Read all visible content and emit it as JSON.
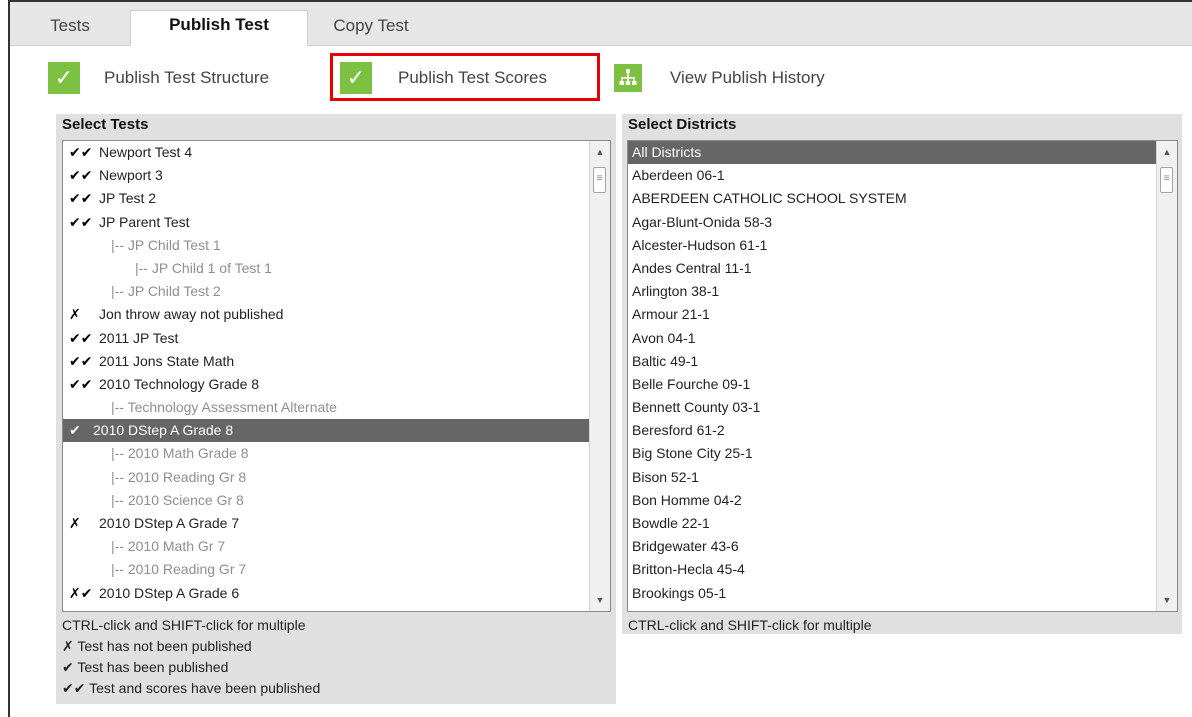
{
  "tabs": [
    {
      "label": "Tests"
    },
    {
      "label": "Publish Test"
    },
    {
      "label": "Copy Test"
    }
  ],
  "actions": [
    {
      "label": "Publish Test Structure",
      "icon": "checkmark-icon"
    },
    {
      "label": "Publish Test Scores",
      "icon": "checkmark-icon"
    },
    {
      "label": "View Publish History",
      "icon": "hierarchy-icon"
    }
  ],
  "tests_panel": {
    "title": "Select Tests",
    "hint": "CTRL-click and SHIFT-click for multiple",
    "items": [
      {
        "mark": "✔✔",
        "label": "Newport Test 4",
        "level": 0
      },
      {
        "mark": "✔✔",
        "label": "Newport 3",
        "level": 0
      },
      {
        "mark": "✔✔",
        "label": "JP Test 2",
        "level": 0
      },
      {
        "mark": "✔✔",
        "label": "JP Parent Test",
        "level": 0
      },
      {
        "mark": "",
        "label": "|-- JP Child Test 1",
        "level": 1
      },
      {
        "mark": "",
        "label": "|-- JP Child 1 of Test 1",
        "level": 2
      },
      {
        "mark": "",
        "label": "|-- JP Child Test 2",
        "level": 1
      },
      {
        "mark": "✗",
        "label": "Jon throw away not published",
        "level": 0
      },
      {
        "mark": "✔✔",
        "label": "2011 JP Test",
        "level": 0
      },
      {
        "mark": "✔✔",
        "label": "2011 Jons State Math",
        "level": 0
      },
      {
        "mark": "✔✔",
        "label": "2010 Technology Grade 8",
        "level": 0
      },
      {
        "mark": "",
        "label": "|-- Technology Assessment Alternate",
        "level": 1
      },
      {
        "mark": "✔",
        "label": "2010 DStep A Grade 8",
        "level": 0,
        "selected": true
      },
      {
        "mark": "",
        "label": "|-- 2010 Math Grade 8",
        "level": 1
      },
      {
        "mark": "",
        "label": "|-- 2010 Reading Gr 8",
        "level": 1
      },
      {
        "mark": "",
        "label": "|-- 2010 Science Gr 8",
        "level": 1
      },
      {
        "mark": "✗",
        "label": "2010 DStep A Grade 7",
        "level": 0
      },
      {
        "mark": "",
        "label": "|-- 2010 Math Gr 7",
        "level": 1
      },
      {
        "mark": "",
        "label": "|-- 2010 Reading Gr 7",
        "level": 1
      },
      {
        "mark": "✗✔",
        "label": "2010 DStep A Grade 6",
        "level": 0
      }
    ],
    "legend": [
      "✗ Test has not been published",
      "✔ Test has been published",
      "✔✔ Test and scores have been published"
    ]
  },
  "districts_panel": {
    "title": "Select Districts",
    "hint": "CTRL-click and SHIFT-click for multiple",
    "items": [
      {
        "label": "All Districts",
        "selected": true
      },
      {
        "label": "Aberdeen 06-1"
      },
      {
        "label": "ABERDEEN CATHOLIC SCHOOL SYSTEM"
      },
      {
        "label": "Agar-Blunt-Onida 58-3"
      },
      {
        "label": "Alcester-Hudson 61-1"
      },
      {
        "label": "Andes Central 11-1"
      },
      {
        "label": "Arlington 38-1"
      },
      {
        "label": "Armour 21-1"
      },
      {
        "label": "Avon 04-1"
      },
      {
        "label": "Baltic 49-1"
      },
      {
        "label": "Belle Fourche 09-1"
      },
      {
        "label": "Bennett County 03-1"
      },
      {
        "label": "Beresford 61-2"
      },
      {
        "label": "Big Stone City 25-1"
      },
      {
        "label": "Bison 52-1"
      },
      {
        "label": "Bon Homme 04-2"
      },
      {
        "label": "Bowdle 22-1"
      },
      {
        "label": "Bridgewater 43-6"
      },
      {
        "label": "Britton-Hecla 45-4"
      },
      {
        "label": "Brookings 05-1"
      }
    ]
  },
  "colors": {
    "accent_green": "#7cc142",
    "highlight_red": "#e60000",
    "selected_row": "#666666"
  }
}
